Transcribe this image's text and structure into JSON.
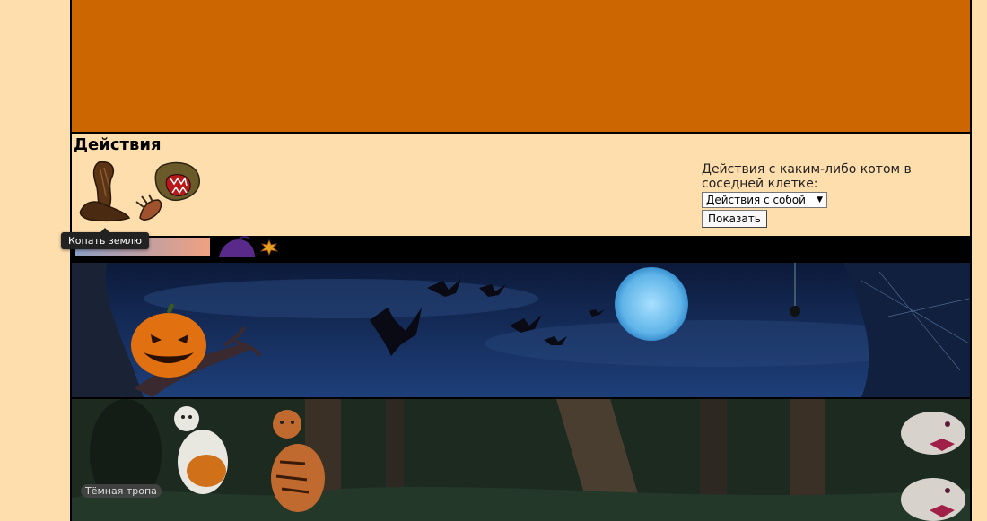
{
  "actions": {
    "title": "Действия",
    "dig_tooltip": "Копать землю",
    "neighbor_label": "Действия с каким-либо котом в соседней клетке:",
    "neighbor_select_value": "Действия с собой",
    "show_button": "Показать"
  },
  "location": {
    "name": "Тёмная тропа"
  },
  "icons": {
    "dig": "dig-paw-icon",
    "claws": "claws-attack-icon",
    "hat": "witch-hat-icon",
    "leaf": "autumn-leaf-icon"
  },
  "colors": {
    "page_background": "#ffdead",
    "top_panel": "#cc6600",
    "status_bar": "#000000"
  }
}
